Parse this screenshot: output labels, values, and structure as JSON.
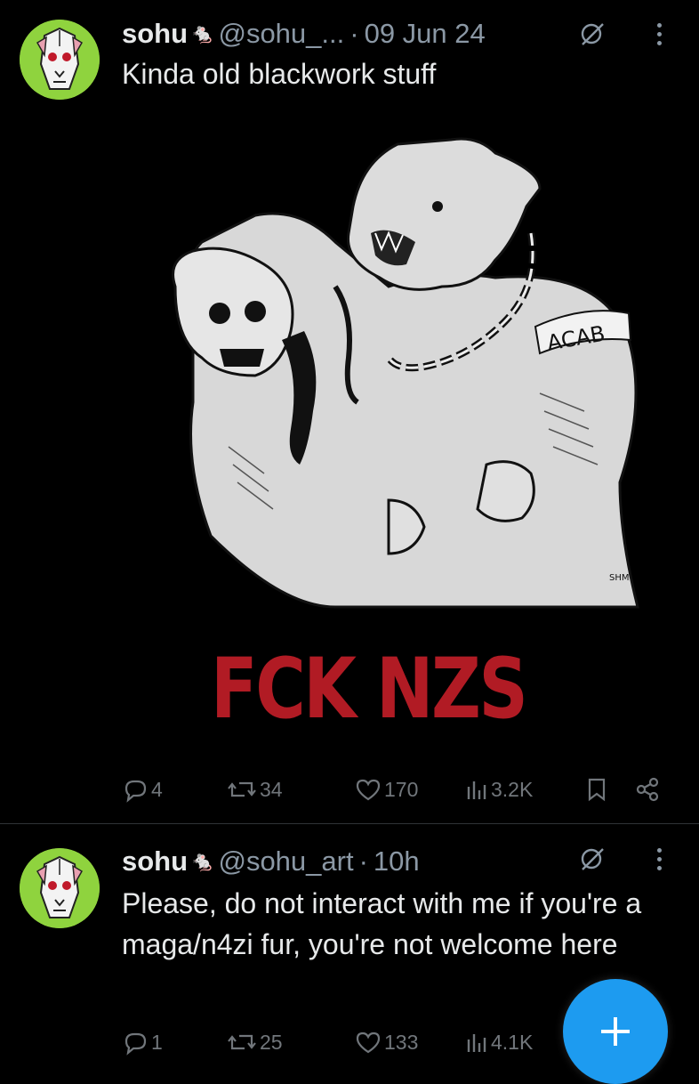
{
  "tweets": [
    {
      "author": {
        "name": "sohu",
        "badge_emoji": "🐁",
        "handle": "@sohu_...",
        "avatar": "rat-skull-avatar"
      },
      "dot": "·",
      "time": "09 Jun 24",
      "text": "Kinda old blackwork stuff",
      "media": {
        "type": "illustration",
        "caption_text": "FCK NZS",
        "tattoo_text": "ACAB",
        "signature": "SHM"
      },
      "stats": {
        "replies": "4",
        "retweets": "34",
        "likes": "170",
        "views": "3.2K"
      }
    },
    {
      "author": {
        "name": "sohu",
        "badge_emoji": "🐁",
        "handle": "@sohu_art",
        "avatar": "rat-skull-avatar"
      },
      "dot": "·",
      "time": "10h",
      "text": "Please, do not interact with me if you're a maga/n4zi fur, you're not welcome here",
      "stats": {
        "replies": "1",
        "retweets": "25",
        "likes": "133",
        "views": "4.1K"
      }
    }
  ],
  "icons": {
    "reply": "reply-icon",
    "retweet": "retweet-icon",
    "like": "heart-icon",
    "views": "views-icon",
    "bookmark": "bookmark-icon",
    "share": "share-icon",
    "grok": "grok-icon",
    "more": "more-icon",
    "compose": "plus-icon"
  },
  "colors": {
    "background": "#000000",
    "text": "#e7e9ea",
    "muted": "#71767b",
    "accent": "#1d9bf0",
    "avatar_bg": "#8fd33e",
    "caption_red": "#b11b24"
  }
}
